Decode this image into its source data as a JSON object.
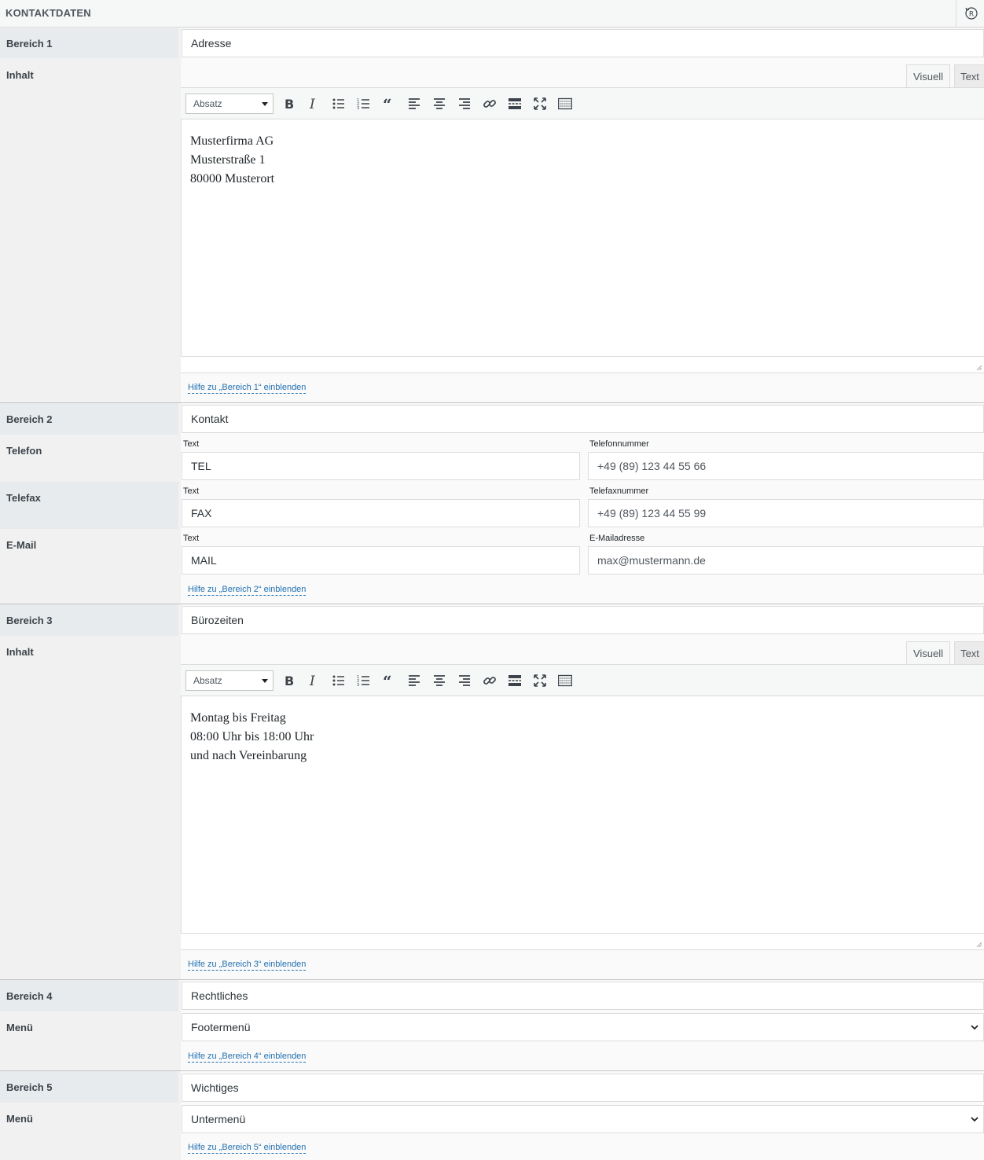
{
  "header": {
    "title": "KONTAKTDATEN",
    "reset_icon": "reset-icon"
  },
  "editor_common": {
    "format_select": "Absatz",
    "tab_visual": "Visuell",
    "tab_text": "Text",
    "toolbar_icons": [
      "bold-icon",
      "italic-icon",
      "bullet-list-icon",
      "numbered-list-icon",
      "blockquote-icon",
      "align-left-icon",
      "align-center-icon",
      "align-right-icon",
      "link-icon",
      "read-more-icon",
      "fullscreen-icon",
      "toolbar-toggle-icon"
    ]
  },
  "section1": {
    "label": "Bereich 1",
    "title_value": "Adresse",
    "content_label": "Inhalt",
    "content_lines": [
      "Musterfirma AG",
      "Musterstraße 1",
      "80000 Musterort"
    ],
    "help": "Hilfe zu „Bereich 1“ einblenden"
  },
  "section2": {
    "label": "Bereich 2",
    "title_value": "Kontakt",
    "telefon": {
      "label": "Telefon",
      "text_label": "Text",
      "text_value": "TEL",
      "number_label": "Telefonnummer",
      "number_value": "+49 (89) 123 44 55 66"
    },
    "telefax": {
      "label": "Telefax",
      "text_label": "Text",
      "text_value": "FAX",
      "number_label": "Telefaxnummer",
      "number_value": "+49 (89) 123 44 55 99"
    },
    "email": {
      "label": "E-Mail",
      "text_label": "Text",
      "text_value": "MAIL",
      "number_label": "E-Mailadresse",
      "number_value": "max@mustermann.de"
    },
    "help": "Hilfe zu „Bereich 2“ einblenden"
  },
  "section3": {
    "label": "Bereich 3",
    "title_value": "Bürozeiten",
    "content_label": "Inhalt",
    "content_lines": [
      "Montag bis Freitag",
      "08:00 Uhr bis 18:00 Uhr",
      "und nach Vereinbarung"
    ],
    "help": "Hilfe zu „Bereich 3“ einblenden"
  },
  "section4": {
    "label": "Bereich 4",
    "title_value": "Rechtliches",
    "menu_label": "Menü",
    "menu_value": "Footermenü",
    "help": "Hilfe zu „Bereich 4“ einblenden"
  },
  "section5": {
    "label": "Bereich 5",
    "title_value": "Wichtiges",
    "menu_label": "Menü",
    "menu_value": "Untermenü",
    "help": "Hilfe zu „Bereich 5“ einblenden"
  }
}
